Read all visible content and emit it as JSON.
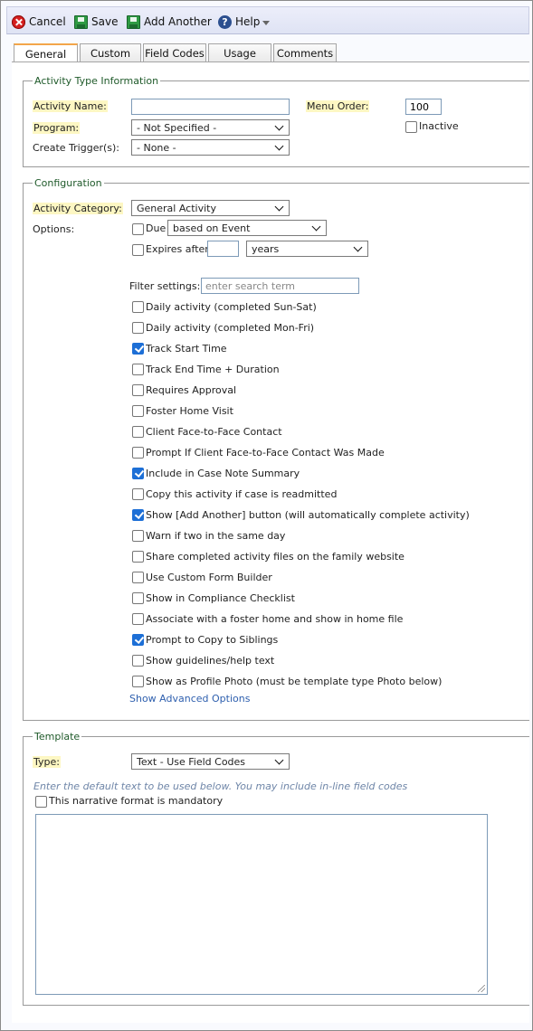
{
  "toolbar": {
    "cancel": "Cancel",
    "save": "Save",
    "add_another": "Add Another",
    "help": "Help",
    "help_glyph": "?"
  },
  "tabs": [
    {
      "label": "General",
      "active": true
    },
    {
      "label": "Custom",
      "active": false
    },
    {
      "label": "Field Codes",
      "active": false
    },
    {
      "label": "Usage",
      "active": false
    },
    {
      "label": "Comments",
      "active": false
    }
  ],
  "activity_type": {
    "legend": "Activity Type Information",
    "name_label": "Activity Name:",
    "name_value": "",
    "program_label": "Program:",
    "program_value": "- Not Specified -",
    "trigger_label": "Create Trigger(s):",
    "trigger_value": "- None -",
    "menu_order_label": "Menu Order:",
    "menu_order_value": "100",
    "inactive_label": "Inactive",
    "inactive_checked": false
  },
  "configuration": {
    "legend": "Configuration",
    "category_label": "Activity Category:",
    "category_value": "General Activity",
    "options_label": "Options:",
    "due_label": "Due",
    "due_value": "based on Event",
    "expires_label": "Expires after",
    "expires_amount": "",
    "expires_unit": "years",
    "filter_label": "Filter settings:",
    "filter_placeholder": "enter search term",
    "options": [
      {
        "label": "Daily activity (completed Sun-Sat)",
        "checked": false
      },
      {
        "label": "Daily activity (completed Mon-Fri)",
        "checked": false
      },
      {
        "label": "Track Start Time",
        "checked": true
      },
      {
        "label": "Track End Time + Duration",
        "checked": false
      },
      {
        "label": "Requires Approval",
        "checked": false
      },
      {
        "label": "Foster Home Visit",
        "checked": false
      },
      {
        "label": "Client Face-to-Face Contact",
        "checked": false
      },
      {
        "label": "Prompt If Client Face-to-Face Contact Was Made",
        "checked": false
      },
      {
        "label": "Include in Case Note Summary",
        "checked": true
      },
      {
        "label": "Copy this activity if case is readmitted",
        "checked": false
      },
      {
        "label": "Show [Add Another] button (will automatically complete activity)",
        "checked": true
      },
      {
        "label": "Warn if two in the same day",
        "checked": false
      },
      {
        "label": "Share completed activity files on the family website",
        "checked": false
      },
      {
        "label": "Use Custom Form Builder",
        "checked": false
      },
      {
        "label": "Show in Compliance Checklist",
        "checked": false
      },
      {
        "label": "Associate with a foster home and show in home file",
        "checked": false
      },
      {
        "label": "Prompt to Copy to Siblings",
        "checked": true
      },
      {
        "label": "Show guidelines/help text",
        "checked": false
      },
      {
        "label": "Show as Profile Photo (must be template type Photo below)",
        "checked": false
      }
    ],
    "advanced_link": "Show Advanced Options"
  },
  "template": {
    "legend": "Template",
    "type_label": "Type:",
    "type_value": "Text - Use Field Codes",
    "hint": "Enter the default text to be used below. You may include in-line field codes",
    "mandatory_label": "This narrative format is mandatory",
    "mandatory_checked": false,
    "default_text": ""
  },
  "colors": {
    "required_highlight": "#fdf7c3",
    "checkbox_checked": "#1d6fd6",
    "legend_text": "#1f5a2a",
    "link": "#2e5fae",
    "active_tab_accent": "#f3a54a"
  }
}
